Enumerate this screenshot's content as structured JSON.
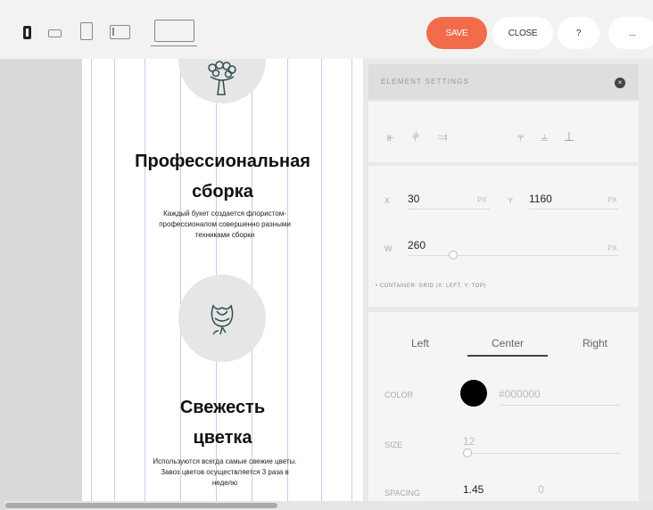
{
  "toolbar": {
    "save_label": "SAVE",
    "close_label": "CLOSE",
    "help_label": "?",
    "more_label": "...",
    "colors": {
      "save": "#f26b4b"
    }
  },
  "canvas": {
    "features": [
      {
        "icon": "bouquet-icon",
        "title_line1": "Профессиональная",
        "title_line2": "сборка",
        "text_lines": [
          "Каждый букет создается флористом-",
          "профессионалом совершенно разными",
          "техниками сборки"
        ]
      },
      {
        "icon": "flower-bud-icon",
        "title_line1": "Свежесть",
        "title_line2": "цветка",
        "text_lines": [
          "Используются всегда самые свежие цветы.",
          "Завоз цветов осуществляется 3 раза в",
          "неделю"
        ]
      }
    ]
  },
  "panel": {
    "title": "ELEMENT SETTINGS",
    "x_label": "X",
    "x_value": "30",
    "x_unit": "PX",
    "y_label": "Y",
    "y_value": "1160",
    "y_unit": "PX",
    "w_label": "W",
    "w_value": "260",
    "w_unit": "PX",
    "container_note": "• CONTAINER: GRID (X: LEFT, Y: TOP)",
    "tabs": [
      "Left",
      "Center",
      "Right"
    ],
    "active_tab": "Center",
    "color_label": "COLOR",
    "color_value": "#000000",
    "size_label": "SIZE",
    "size_value": "12",
    "spacing_label": "SPACING",
    "spacing_value": "1.45",
    "spacing_value2": "0"
  }
}
